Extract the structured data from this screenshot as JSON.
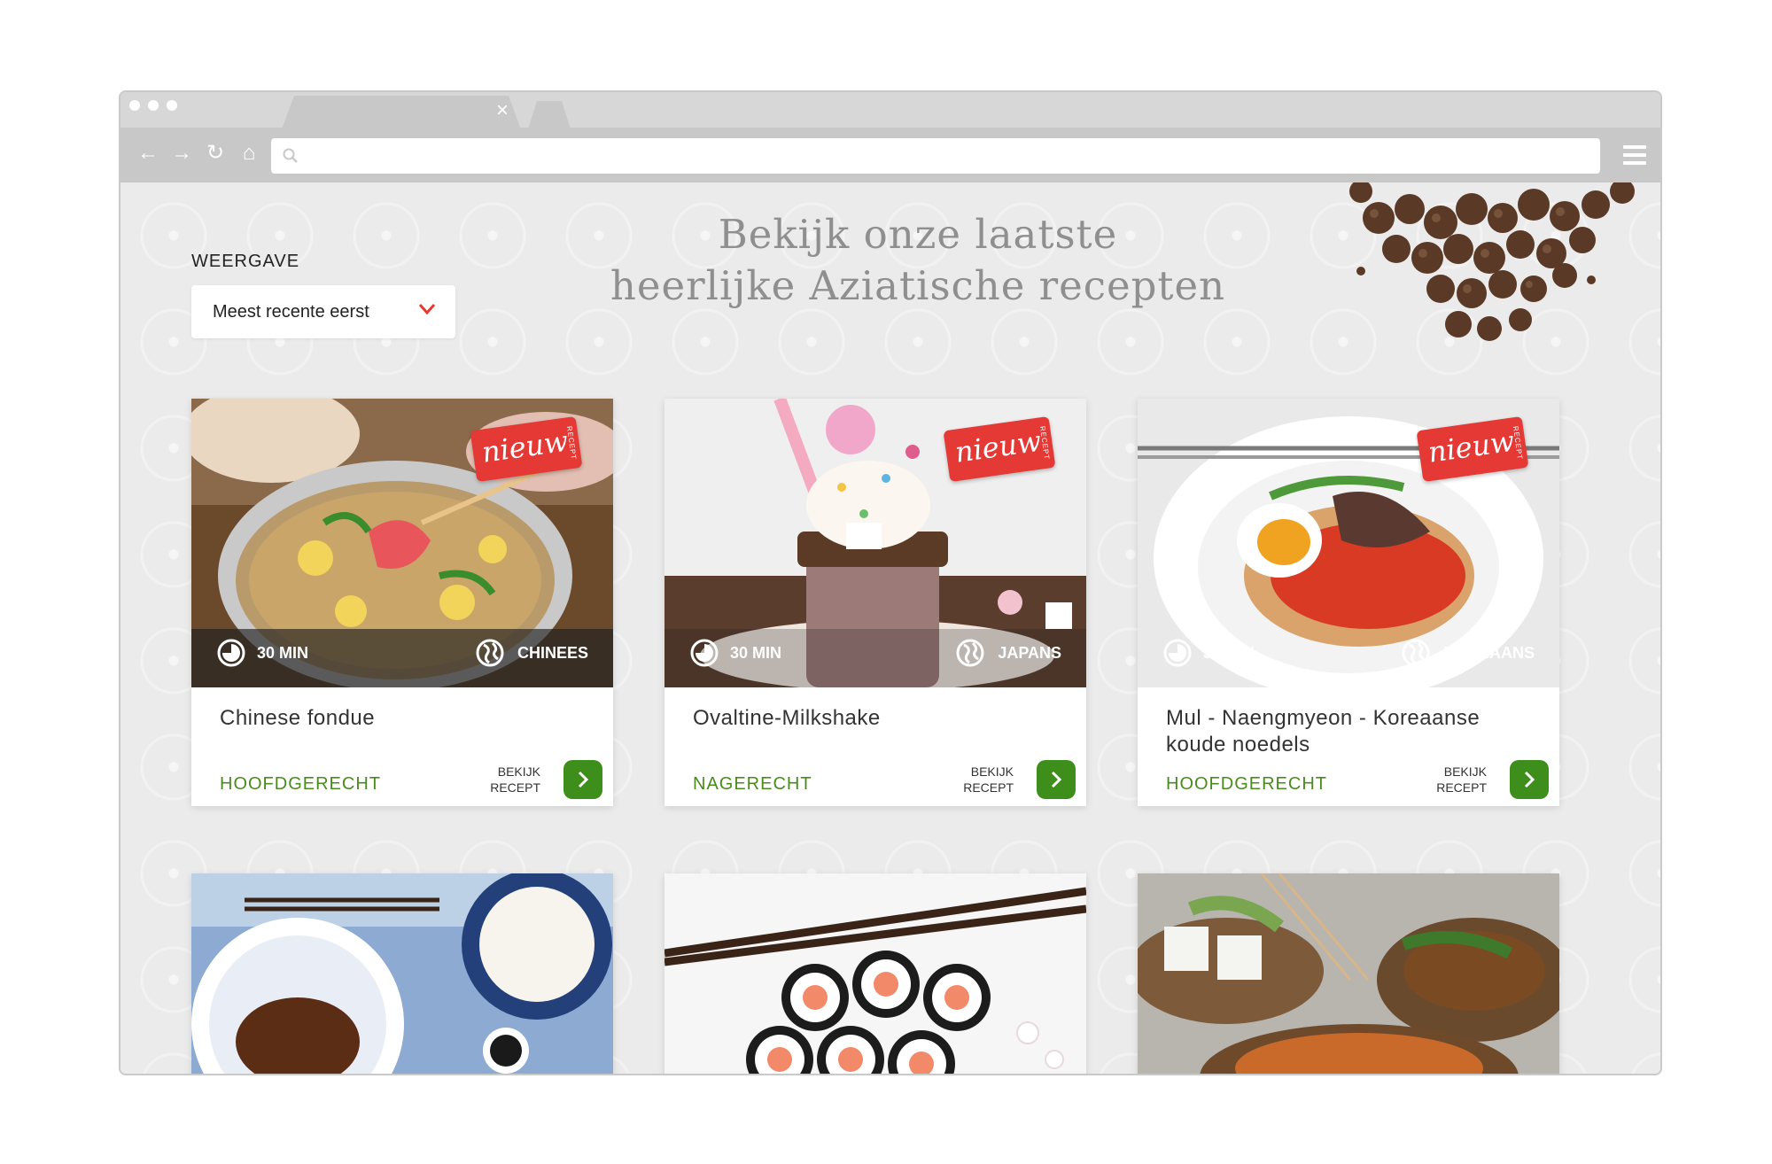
{
  "browser": {
    "tab_close": "×",
    "url": ""
  },
  "page": {
    "heading_line1": "Bekijk onze laatste",
    "heading_line2": "heerlijke Aziatische recepten",
    "view_label": "WEERGAVE",
    "sort_selected": "Meest recente eerst"
  },
  "badge": {
    "main": "nieuw",
    "sub": "RECEPT"
  },
  "cta_label_line1": "BEKIJK",
  "cta_label_line2": "RECEPT",
  "colors": {
    "accent_red": "#e53935",
    "accent_green": "#3e8e1c",
    "category_green": "#4a8c1c",
    "heading_gray": "#8f8f8f"
  },
  "recipes": [
    {
      "title": "Chinese fondue",
      "time": "30 MIN",
      "cuisine": "CHINEES",
      "category": "HOOFDGERECHT",
      "image": "hot-pot-photo"
    },
    {
      "title": "Ovaltine-Milkshake",
      "time": "30 MIN",
      "cuisine": "JAPANS",
      "category": "NAGERECHT",
      "image": "milkshake-photo"
    },
    {
      "title": "Mul - Naengmyeon - Koreaanse koude noedels",
      "time": "30 MIN",
      "cuisine": "KOREAANS",
      "category": "HOOFDGERECHT",
      "image": "cold-noodles-photo"
    },
    {
      "image": "glazed-fish-rice-photo"
    },
    {
      "image": "sushi-rolls-photo"
    },
    {
      "image": "satay-skewers-photo"
    }
  ]
}
